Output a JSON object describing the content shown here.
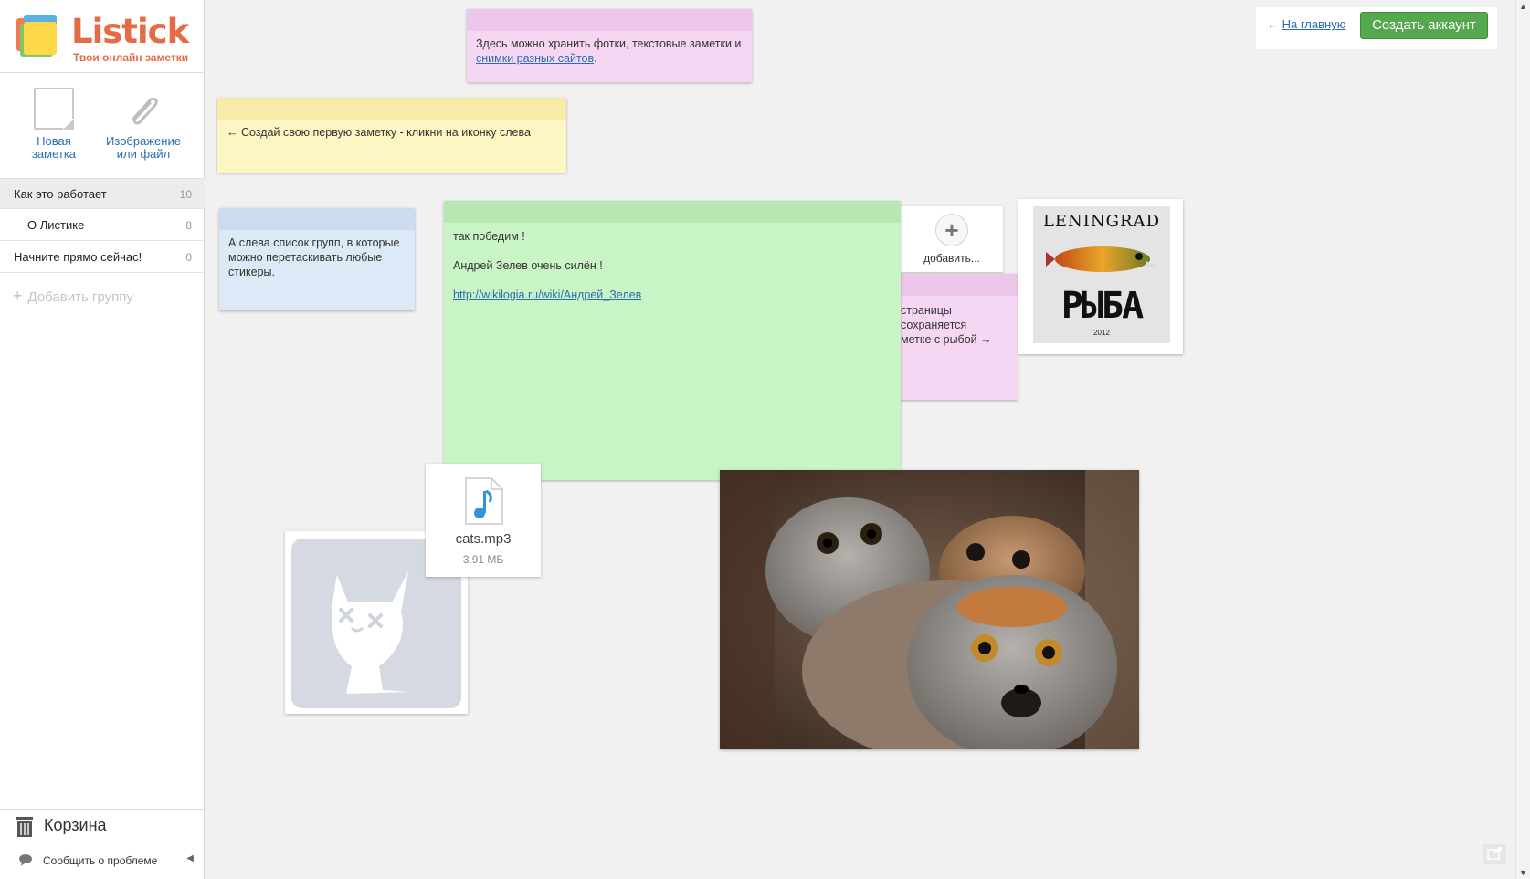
{
  "app": {
    "name": "Listick",
    "tagline": "Твои онлайн заметки"
  },
  "tools": {
    "new_note": "Новая заметка",
    "image_or_file": "Изображение или файл"
  },
  "groups": [
    {
      "label": "Как это работает",
      "count": "10"
    },
    {
      "label": "О Листике",
      "count": "8"
    },
    {
      "label": "Начните прямо сейчас!",
      "count": "0"
    }
  ],
  "add_group": "Добавить группу",
  "trash": "Корзина",
  "report": "Сообщить о проблеме",
  "topbar": {
    "back_arrow": "←",
    "back_link": "На главную",
    "create_account": "Создать аккаунт"
  },
  "stickers": {
    "pink_text": "Здесь можно хранить фотки, текстовые заметки и",
    "pink_link": "снимки разных сайтов",
    "pink_end": ".",
    "yellow_text": "← Создай свою первую заметку - кликни на иконку слева",
    "blue_text": "А слева список групп, в которые можно перетаскивать любые стикеры.",
    "pink2_line1": "страницы",
    "pink2_line2": "сохраняется",
    "pink2_line3": "метке с рыбой →",
    "green_line1": "так победим !",
    "green_line2": "Андрей Зелев очень силён !",
    "green_link": "http://wikilogia.ru/wiki/Андрей_Зелев"
  },
  "add_card": {
    "label": "добавить..."
  },
  "leningrad": {
    "title": "LENINGRAD",
    "big": "РЫБА",
    "year": "2012"
  },
  "file": {
    "name": "cats.mp3",
    "size": "3.91 МБ"
  },
  "colors": {
    "brand": "#e56b45",
    "accent_green": "#55a84e",
    "link": "#2a6db2"
  }
}
